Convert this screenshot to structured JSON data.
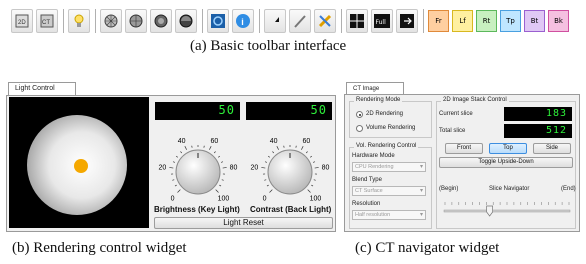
{
  "toolbar": {
    "buttons": [
      {
        "icon": "grid-2d-icon"
      },
      {
        "icon": "ct-image-icon"
      },
      {
        "icon": "light-bulb-icon"
      },
      {
        "icon": "volume-grid-icon"
      },
      {
        "icon": "volume-sphere-icon"
      },
      {
        "icon": "volume-cube-icon"
      },
      {
        "icon": "volume-shaded-icon"
      },
      {
        "icon": "rotate-view-icon"
      },
      {
        "icon": "info-icon"
      },
      {
        "icon": "pointer-arrow-icon"
      },
      {
        "icon": "line-tool-icon"
      },
      {
        "icon": "tools-icon"
      }
    ],
    "layout_buttons": [
      {
        "icon": "quad-layout-icon",
        "label": ""
      },
      {
        "icon": "full-layout-icon",
        "label": "Full"
      },
      {
        "icon": "exit-layout-icon",
        "label": ""
      }
    ],
    "view_buttons": [
      {
        "label": "Fr",
        "color": "#ffcfa0",
        "border": "#e08a3a"
      },
      {
        "label": "Lf",
        "color": "#fff0a0",
        "border": "#d8b820"
      },
      {
        "label": "Rt",
        "color": "#c8f0c0",
        "border": "#5cb85c"
      },
      {
        "label": "Tp",
        "color": "#bfe6ff",
        "border": "#4aa0e0"
      },
      {
        "label": "Bt",
        "color": "#e0c8f5",
        "border": "#9a60d0"
      },
      {
        "label": "Bk",
        "color": "#f5c0e0",
        "border": "#d050a0"
      }
    ]
  },
  "captions": {
    "toolbar": "(a) Basic toolbar interface",
    "light": "(b) Rendering control widget",
    "ct": "(c) CT navigator widget"
  },
  "light_control": {
    "tab": "Light Control",
    "brightness_value": "50",
    "contrast_value": "50",
    "brightness_label": "Brightness (Key Light)",
    "contrast_label": "Contrast (Back Light)",
    "dial_ticks": [
      "0",
      "20",
      "40",
      "60",
      "80",
      "100"
    ],
    "reset_label": "Light Reset",
    "light_color": "#f5a800"
  },
  "ct_control": {
    "tab": "CT Image Control",
    "rendering_mode": {
      "title": "Rendering Mode",
      "options": [
        "2D Rendering",
        "Volume Rendering"
      ],
      "selected": "2D Rendering"
    },
    "vol_rendering": {
      "title": "Vol. Rendering Control",
      "hardware_label": "Hardware Mode",
      "hardware_value": "CPU Rendering",
      "blend_label": "Blend Type",
      "blend_value": "CT Surface",
      "resolution_label": "Resolution",
      "resolution_value": "Half resolution"
    },
    "stack_control": {
      "title": "2D Image Stack Control",
      "current_label": "Current slice",
      "current_value": "183",
      "total_label": "Total slice",
      "total_value": "512",
      "buttons": [
        "Front",
        "Top",
        "Side"
      ],
      "active": "Top",
      "toggle_label": "Toggle Upside-Down",
      "begin_label": "(Begin)",
      "navigator_label": "Slice Navigator",
      "end_label": "(End)",
      "slider_position": 0.36
    }
  }
}
